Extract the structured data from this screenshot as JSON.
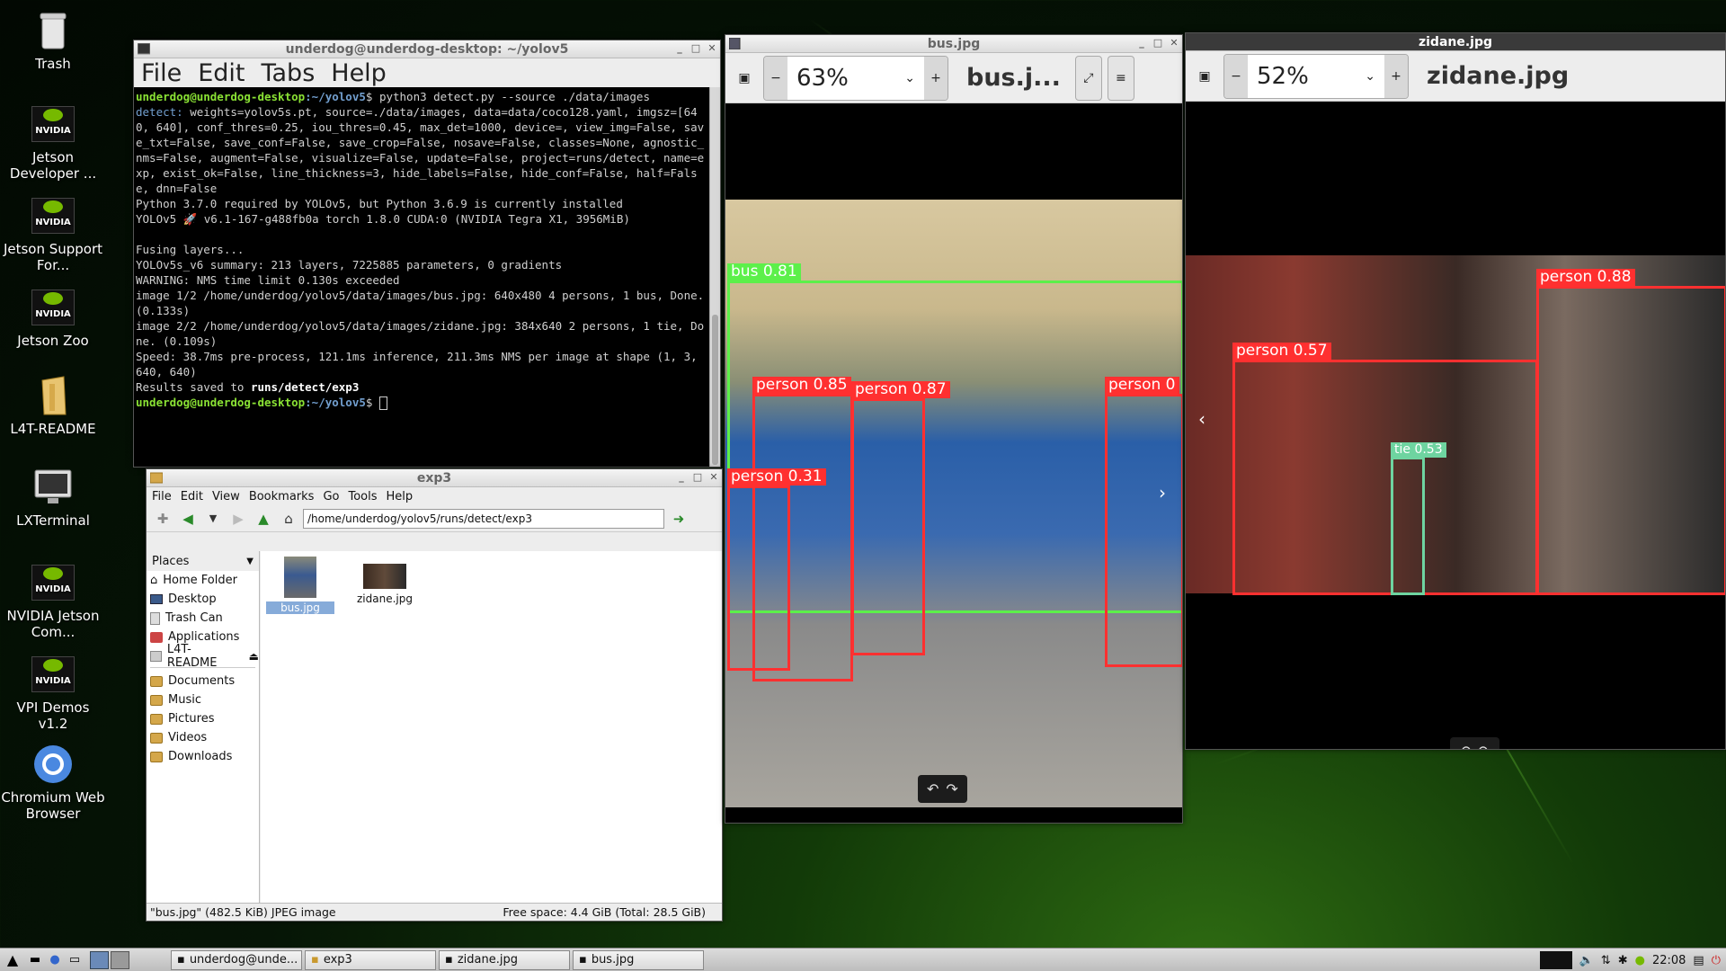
{
  "desktop": {
    "icons": [
      {
        "label": "Trash",
        "icon": "trash-icon"
      },
      {
        "label": "Jetson Developer ...",
        "icon": "nvidia-logo-icon"
      },
      {
        "label": "Jetson Support For...",
        "icon": "nvidia-logo-icon"
      },
      {
        "label": "Jetson Zoo",
        "icon": "nvidia-logo-icon"
      },
      {
        "label": "L4T-README",
        "icon": "folder-icon"
      },
      {
        "label": "LXTerminal",
        "icon": "monitor-icon"
      },
      {
        "label": "NVIDIA Jetson Com...",
        "icon": "nvidia-logo-icon"
      },
      {
        "label": "VPI Demos v1.2",
        "icon": "nvidia-logo-icon"
      },
      {
        "label": "Chromium Web Browser",
        "icon": "chromium-icon"
      }
    ]
  },
  "terminal": {
    "title": "underdog@underdog-desktop: ~/yolov5",
    "menu": [
      "File",
      "Edit",
      "Tabs",
      "Help"
    ],
    "prompt_user": "underdog@underdog-desktop",
    "prompt_path": ":~/yolov5",
    "prompt_sym": "$ ",
    "command": "python3 detect.py --source ./data/images",
    "detect_kw": "detect:",
    "detect_args": " weights=yolov5s.pt, source=./data/images, data=data/coco128.yaml, imgsz=[640, 640], conf_thres=0.25, iou_thres=0.45, max_det=1000, device=, view_img=False, save_txt=False, save_conf=False, save_crop=False, nosave=False, classes=None, agnostic_nms=False, augment=False, visualize=False, update=False, project=runs/detect, name=exp, exist_ok=False, line_thickness=3, hide_labels=False, hide_conf=False, half=False, dnn=False",
    "lines": [
      "Python 3.7.0 required by YOLOv5, but Python 3.6.9 is currently installed",
      "YOLOv5 🚀 v6.1-167-g488fb0a torch 1.8.0 CUDA:0 (NVIDIA Tegra X1, 3956MiB)",
      "",
      "Fusing layers...",
      "YOLOv5s_v6 summary: 213 layers, 7225885 parameters, 0 gradients",
      "WARNING: NMS time limit 0.130s exceeded",
      "image 1/2 /home/underdog/yolov5/data/images/bus.jpg: 640x480 4 persons, 1 bus, Done. (0.133s)",
      "image 2/2 /home/underdog/yolov5/data/images/zidane.jpg: 384x640 2 persons, 1 tie, Done. (0.109s)",
      "Speed: 38.7ms pre-process, 121.1ms inference, 211.3ms NMS per image at shape (1, 3, 640, 640)"
    ],
    "results_prefix": "Results saved to ",
    "results_path": "runs/detect/exp3"
  },
  "filemanager": {
    "title": "exp3",
    "menu": [
      "File",
      "Edit",
      "View",
      "Bookmarks",
      "Go",
      "Tools",
      "Help"
    ],
    "path": "/home/underdog/yolov5/runs/detect/exp3",
    "places_label": "Places",
    "places": [
      {
        "label": "Home Folder",
        "icon": "home-icon"
      },
      {
        "label": "Desktop",
        "icon": "desktop-icon"
      },
      {
        "label": "Trash Can",
        "icon": "trash-icon"
      },
      {
        "label": "Applications",
        "icon": "applications-icon"
      },
      {
        "label": "L4T-README",
        "icon": "drive-icon"
      }
    ],
    "bookmarks": [
      "Documents",
      "Music",
      "Pictures",
      "Videos",
      "Downloads"
    ],
    "files": [
      {
        "name": "bus.jpg",
        "selected": true
      },
      {
        "name": "zidane.jpg",
        "selected": false
      }
    ],
    "status_left": "\"bus.jpg\" (482.5 KiB) JPEG image",
    "status_right": "Free space: 4.4 GiB (Total: 28.5 GiB)"
  },
  "viewer_bus": {
    "window_title": "bus.jpg",
    "zoom": "63%",
    "title": "bus.j...",
    "detections": [
      {
        "label": "bus  0.81",
        "color": "#5cf04a"
      },
      {
        "label": "person  0.85",
        "color": "#ff3030"
      },
      {
        "label": "person  0.87",
        "color": "#ff3030"
      },
      {
        "label": "person  0",
        "color": "#ff3030"
      },
      {
        "label": "person  0.31",
        "color": "#ff3030"
      }
    ]
  },
  "viewer_zidane": {
    "window_title": "zidane.jpg",
    "zoom": "52%",
    "title": "zidane.jpg",
    "detections": [
      {
        "label": "person  0.88",
        "color": "#ff3030"
      },
      {
        "label": "person  0.57",
        "color": "#ff3030"
      },
      {
        "label": "tie  0.53",
        "color": "#6ed4a0"
      }
    ]
  },
  "taskbar": {
    "tasks": [
      {
        "label": "underdog@unde...",
        "icon": "terminal-icon"
      },
      {
        "label": "exp3",
        "icon": "folder-icon"
      },
      {
        "label": "zidane.jpg",
        "icon": "image-icon"
      },
      {
        "label": "bus.jpg",
        "icon": "image-icon"
      }
    ],
    "clock": "22:08"
  }
}
